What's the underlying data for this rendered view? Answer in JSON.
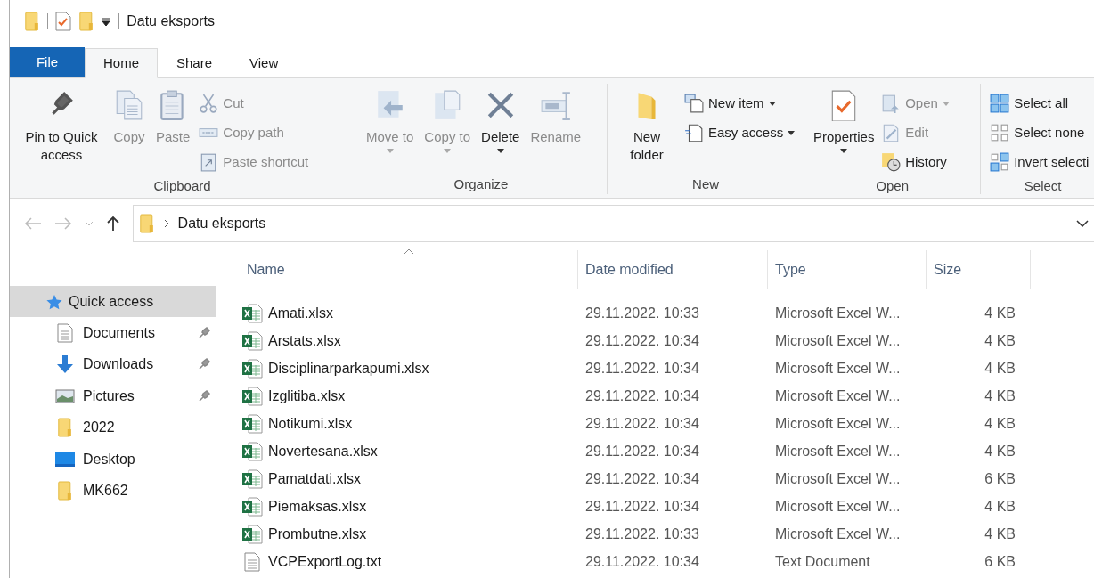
{
  "title_bar": {
    "title": "Datu eksports"
  },
  "ribbon_tabs": [
    {
      "label": "File",
      "kind": "file",
      "selected": false
    },
    {
      "label": "Home",
      "kind": "tab",
      "selected": true
    },
    {
      "label": "Share",
      "kind": "tab",
      "selected": false
    },
    {
      "label": "View",
      "kind": "tab",
      "selected": false
    }
  ],
  "ribbon_groups": [
    {
      "label": "Clipboard",
      "items": [
        {
          "label": "Pin to Quick access",
          "kind": "large",
          "disabled": false,
          "dropdown": false
        },
        {
          "label": "Copy",
          "kind": "large",
          "disabled": true,
          "dropdown": false
        },
        {
          "label": "Paste",
          "kind": "large",
          "disabled": true,
          "dropdown": false
        },
        {
          "label": "Cut",
          "kind": "small",
          "disabled": true,
          "dropdown": false
        },
        {
          "label": "Copy path",
          "kind": "small",
          "disabled": true,
          "dropdown": false
        },
        {
          "label": "Paste shortcut",
          "kind": "small",
          "disabled": true,
          "dropdown": false
        }
      ]
    },
    {
      "label": "Organize",
      "items": [
        {
          "label": "Move to",
          "kind": "large",
          "disabled": true,
          "dropdown": true
        },
        {
          "label": "Copy to",
          "kind": "large",
          "disabled": true,
          "dropdown": true
        },
        {
          "label": "Delete",
          "kind": "large",
          "disabled": false,
          "dropdown": true
        },
        {
          "label": "Rename",
          "kind": "large",
          "disabled": true,
          "dropdown": false
        }
      ]
    },
    {
      "label": "New",
      "items": [
        {
          "label": "New folder",
          "kind": "large",
          "disabled": false,
          "dropdown": false
        },
        {
          "label": "New item",
          "kind": "small",
          "disabled": false,
          "dropdown": true
        },
        {
          "label": "Easy access",
          "kind": "small",
          "disabled": false,
          "dropdown": true
        }
      ]
    },
    {
      "label": "Open",
      "items": [
        {
          "label": "Properties",
          "kind": "large",
          "disabled": false,
          "dropdown": true
        },
        {
          "label": "Open",
          "kind": "small",
          "disabled": true,
          "dropdown": true
        },
        {
          "label": "Edit",
          "kind": "small",
          "disabled": true,
          "dropdown": false
        },
        {
          "label": "History",
          "kind": "small",
          "disabled": false,
          "dropdown": false
        }
      ]
    },
    {
      "label": "Select",
      "items": [
        {
          "label": "Select all",
          "kind": "small",
          "disabled": false,
          "dropdown": false
        },
        {
          "label": "Select none",
          "kind": "small",
          "disabled": false,
          "dropdown": false
        },
        {
          "label": "Invert selecti",
          "kind": "small",
          "disabled": false,
          "dropdown": false
        }
      ]
    }
  ],
  "address_bar": {
    "back_disabled": true,
    "forward_disabled": true,
    "path": "Datu eksports"
  },
  "sidebar": {
    "items": [
      {
        "label": "Quick access",
        "selected": true,
        "children": [
          {
            "label": "Documents",
            "pinned": true,
            "selected": false
          },
          {
            "label": "Downloads",
            "pinned": true,
            "selected": false
          },
          {
            "label": "Pictures",
            "pinned": true,
            "selected": false
          },
          {
            "label": "2022",
            "pinned": false,
            "selected": false
          },
          {
            "label": "Desktop",
            "pinned": false,
            "selected": false
          },
          {
            "label": "MK662",
            "pinned": false,
            "selected": false
          }
        ]
      }
    ]
  },
  "file_list": {
    "columns": [
      {
        "label": "Name",
        "sorted": true
      },
      {
        "label": "Date modified",
        "sorted": false
      },
      {
        "label": "Type",
        "sorted": false
      },
      {
        "label": "Size",
        "sorted": false
      }
    ],
    "rows": [
      {
        "name": "Amati.xlsx",
        "date": "29.11.2022. 10:33",
        "type": "Microsoft Excel W...",
        "size": "4 KB",
        "kind": "excel"
      },
      {
        "name": "Arstats.xlsx",
        "date": "29.11.2022. 10:34",
        "type": "Microsoft Excel W...",
        "size": "4 KB",
        "kind": "excel"
      },
      {
        "name": "Disciplinarparkapumi.xlsx",
        "date": "29.11.2022. 10:34",
        "type": "Microsoft Excel W...",
        "size": "4 KB",
        "kind": "excel"
      },
      {
        "name": "Izglitiba.xlsx",
        "date": "29.11.2022. 10:34",
        "type": "Microsoft Excel W...",
        "size": "4 KB",
        "kind": "excel"
      },
      {
        "name": "Notikumi.xlsx",
        "date": "29.11.2022. 10:34",
        "type": "Microsoft Excel W...",
        "size": "4 KB",
        "kind": "excel"
      },
      {
        "name": "Novertesana.xlsx",
        "date": "29.11.2022. 10:34",
        "type": "Microsoft Excel W...",
        "size": "4 KB",
        "kind": "excel"
      },
      {
        "name": "Pamatdati.xlsx",
        "date": "29.11.2022. 10:34",
        "type": "Microsoft Excel W...",
        "size": "6 KB",
        "kind": "excel"
      },
      {
        "name": "Piemaksas.xlsx",
        "date": "29.11.2022. 10:34",
        "type": "Microsoft Excel W...",
        "size": "4 KB",
        "kind": "excel"
      },
      {
        "name": "Prombutne.xlsx",
        "date": "29.11.2022. 10:33",
        "type": "Microsoft Excel W...",
        "size": "4 KB",
        "kind": "excel"
      },
      {
        "name": "VCPExportLog.txt",
        "date": "29.11.2022. 10:34",
        "type": "Text Document",
        "size": "6 KB",
        "kind": "text"
      }
    ]
  }
}
